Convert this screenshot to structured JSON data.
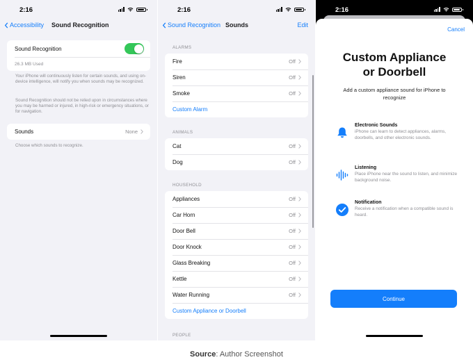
{
  "status": {
    "time": "2:16"
  },
  "screen1": {
    "back_label": "Accessibility",
    "title": "Sound Recognition",
    "toggle_label": "Sound Recognition",
    "toggle_on": true,
    "storage": "26.3 MB Used",
    "desc1": "Your iPhone will continuously listen for certain sounds, and using on-device intelligence, will notify you when sounds may be recognized.",
    "desc2": "Sound Recognition should not be relied upon in circumstances where you may be harmed or injured, in high-risk or emergency situations, or for navigation.",
    "sounds_label": "Sounds",
    "sounds_value": "None",
    "sounds_footer": "Choose which sounds to recognize."
  },
  "screen2": {
    "back_label": "Sound Recognition",
    "title": "Sounds",
    "edit_label": "Edit",
    "alarms_header": "ALARMS",
    "alarms": [
      {
        "label": "Fire",
        "value": "Off"
      },
      {
        "label": "Siren",
        "value": "Off"
      },
      {
        "label": "Smoke",
        "value": "Off"
      }
    ],
    "custom_alarm": "Custom Alarm",
    "animals_header": "ANIMALS",
    "animals": [
      {
        "label": "Cat",
        "value": "Off"
      },
      {
        "label": "Dog",
        "value": "Off"
      }
    ],
    "household_header": "HOUSEHOLD",
    "household": [
      {
        "label": "Appliances",
        "value": "Off"
      },
      {
        "label": "Car Horn",
        "value": "Off"
      },
      {
        "label": "Door Bell",
        "value": "Off"
      },
      {
        "label": "Door Knock",
        "value": "Off"
      },
      {
        "label": "Glass Breaking",
        "value": "Off"
      },
      {
        "label": "Kettle",
        "value": "Off"
      },
      {
        "label": "Water Running",
        "value": "Off"
      }
    ],
    "custom_appliance": "Custom Appliance or Doorbell",
    "people_header": "PEOPLE"
  },
  "screen3": {
    "cancel_label": "Cancel",
    "title_line1": "Custom Appliance",
    "title_line2": "or Doorbell",
    "subtitle": "Add a custom appliance sound for iPhone to recognize",
    "features": [
      {
        "icon": "bell-icon",
        "title": "Electronic Sounds",
        "desc": "iPhone can learn to detect appliances, alarms, doorbells, and other electronic sounds."
      },
      {
        "icon": "waveform-icon",
        "title": "Listening",
        "desc": "Place iPhone near the sound to listen, and minimize background noise."
      },
      {
        "icon": "checkmark-circle-icon",
        "title": "Notification",
        "desc": "Receive a notification when a compatible sound is heard."
      }
    ],
    "continue_label": "Continue"
  },
  "caption": {
    "source_label": "Source",
    "source_text": ": Author Screenshot"
  },
  "colors": {
    "accent": "#147efb",
    "toggle_on": "#34c759",
    "background": "#f2f2f7"
  }
}
